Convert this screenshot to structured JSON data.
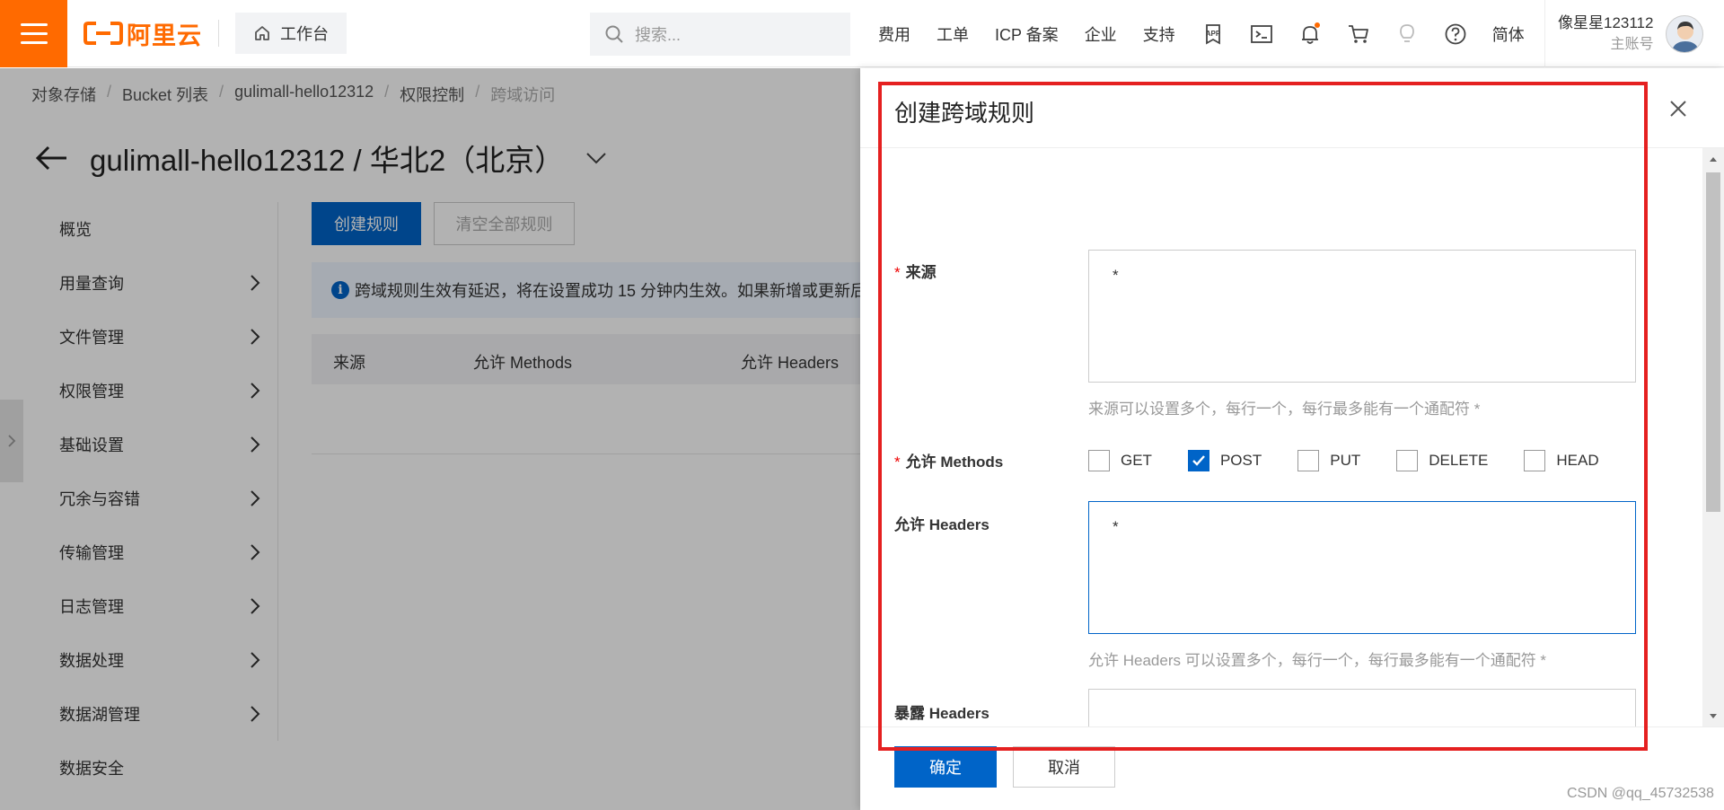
{
  "topbar": {
    "logo_text": "阿里云",
    "workbench_label": "工作台",
    "search_placeholder": "搜索...",
    "nav_items": [
      "费用",
      "工单",
      "ICP 备案",
      "企业",
      "支持"
    ],
    "lang_label": "简体",
    "user_name": "像星星123112",
    "user_sub": "主账号",
    "accent_color": "#ff6a00",
    "icons": [
      "app-icon",
      "terminal-icon",
      "bell-icon",
      "cart-icon",
      "bulb-icon",
      "help-icon"
    ]
  },
  "breadcrumb": [
    "对象存储",
    "Bucket 列表",
    "gulimall-hello12312",
    "权限控制",
    "跨域访问"
  ],
  "page_title": "gulimall-hello12312 / 华北2（北京）",
  "sidebar": {
    "items": [
      {
        "label": "概览",
        "arrow": false
      },
      {
        "label": "用量查询",
        "arrow": true
      },
      {
        "label": "文件管理",
        "arrow": true
      },
      {
        "label": "权限管理",
        "arrow": true
      },
      {
        "label": "基础设置",
        "arrow": true
      },
      {
        "label": "冗余与容错",
        "arrow": true
      },
      {
        "label": "传输管理",
        "arrow": true
      },
      {
        "label": "日志管理",
        "arrow": true
      },
      {
        "label": "数据处理",
        "arrow": true
      },
      {
        "label": "数据湖管理",
        "arrow": true
      },
      {
        "label": "数据安全",
        "arrow": false
      }
    ]
  },
  "main": {
    "create_button": "创建规则",
    "clear_button": "清空全部规则",
    "notice_text": "跨域规则生效有延迟，将在设置成功 15 分钟内生效。如果新增或更新后",
    "table_headers": [
      "来源",
      "允许 Methods",
      "允许 Headers"
    ]
  },
  "drawer": {
    "title": "创建跨域规则",
    "fields": {
      "origin": {
        "label": "来源",
        "value": "*",
        "help": "来源可以设置多个，每行一个，每行最多能有一个通配符 *"
      },
      "methods": {
        "label_cn": "允许",
        "label_en": "Methods",
        "options": [
          {
            "label": "GET",
            "checked": false
          },
          {
            "label": "POST",
            "checked": true
          },
          {
            "label": "PUT",
            "checked": false
          },
          {
            "label": "DELETE",
            "checked": false
          },
          {
            "label": "HEAD",
            "checked": false
          }
        ]
      },
      "allow_headers": {
        "label_cn": "允许",
        "label_en": "Headers",
        "value": "*",
        "help": "允许 Headers 可以设置多个，每行一个，每行最多能有一个通配符 *"
      },
      "expose_headers": {
        "label_cn": "暴露",
        "label_en": "Headers",
        "value": ""
      }
    },
    "ok_button": "确定",
    "cancel_button": "取消",
    "primary_color": "#0064c8",
    "highlight_color": "#e52020"
  },
  "watermark": "CSDN @qq_45732538"
}
